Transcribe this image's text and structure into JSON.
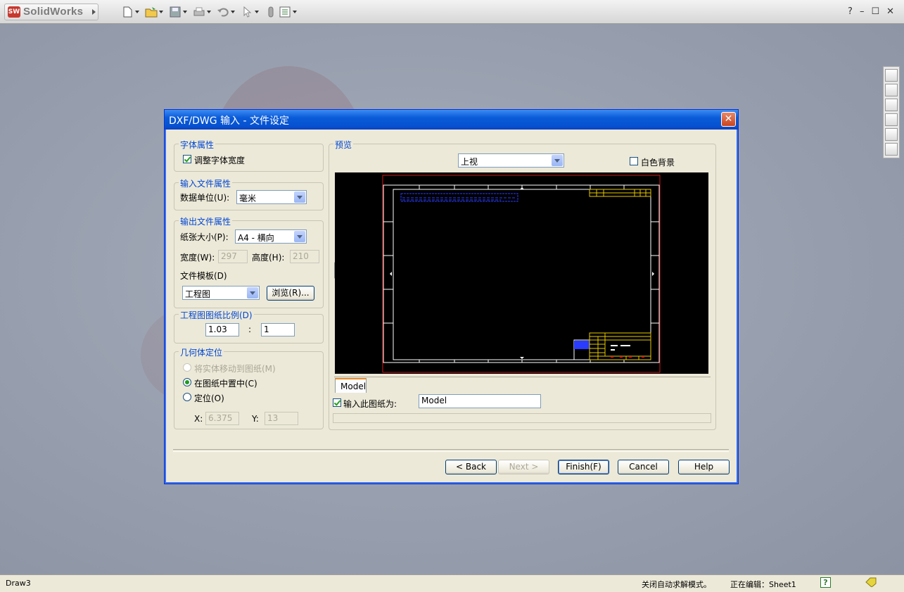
{
  "app": {
    "title": "SolidWorks"
  },
  "statusbar": {
    "left": "Draw3",
    "mode": "关闭自动求解模式。",
    "editing": "正在编辑：Sheet1",
    "help_glyph": "?"
  },
  "window_controls": {
    "help": "?",
    "minimize": "–",
    "restore": "☐",
    "close": "✕"
  },
  "dialog": {
    "title": "DXF/DWG 输入 - 文件设定",
    "close_label": "✕",
    "font_group": {
      "label": "字体属性",
      "adjust_width": {
        "label": "调整字体宽度",
        "checked": true
      }
    },
    "input_group": {
      "label": "输入文件属性",
      "unit_label": "数据单位(U):",
      "unit_value": "毫米"
    },
    "output_group": {
      "label": "输出文件属性",
      "paper_label": "纸张大小(P):",
      "paper_value": "A4 - 横向",
      "width_label": "宽度(W):",
      "width_value": "297",
      "height_label": "高度(H):",
      "height_value": "210",
      "template_label": "文件模板(D)",
      "template_value": "工程图",
      "browse_label": "浏览(R)..."
    },
    "scale_group": {
      "label": "工程图图纸比例(D)",
      "num": "1.03",
      "sep": ":",
      "den": "1"
    },
    "geom_group": {
      "label": "几何体定位",
      "opt_move": "将实体移动到图纸(M)",
      "opt_center": "在图纸中置中(C)",
      "opt_position": "定位(O)",
      "selected": "center",
      "x_label": "X:",
      "x_value": "6.375",
      "y_label": "Y:",
      "y_value": "13"
    },
    "preview_group": {
      "label": "预览",
      "view_value": "上视",
      "white_bg": {
        "label": "白色背景",
        "checked": false
      },
      "tools": [
        "select-icon",
        "zoom-fit-icon",
        "zoom-area-icon",
        "zoom-inout-icon",
        "rotate-icon",
        "pan-icon"
      ],
      "tab": "Model",
      "import_as": {
        "label": "输入此图纸为:",
        "checked": true,
        "value": "Model"
      }
    },
    "buttons": {
      "back": "< Back",
      "next": "Next >",
      "finish": "Finish(F)",
      "cancel": "Cancel",
      "help": "Help"
    }
  },
  "colors": {
    "titlebar": "#0a5bd8",
    "group_label": "#0046d5",
    "dialog_bg": "#ece9d8",
    "preview_bg": "#000000",
    "sheet_border": "#d01818",
    "drawing_line": "#ffffff",
    "title_block": "#e8c800",
    "text_blue": "#2a3cff"
  }
}
